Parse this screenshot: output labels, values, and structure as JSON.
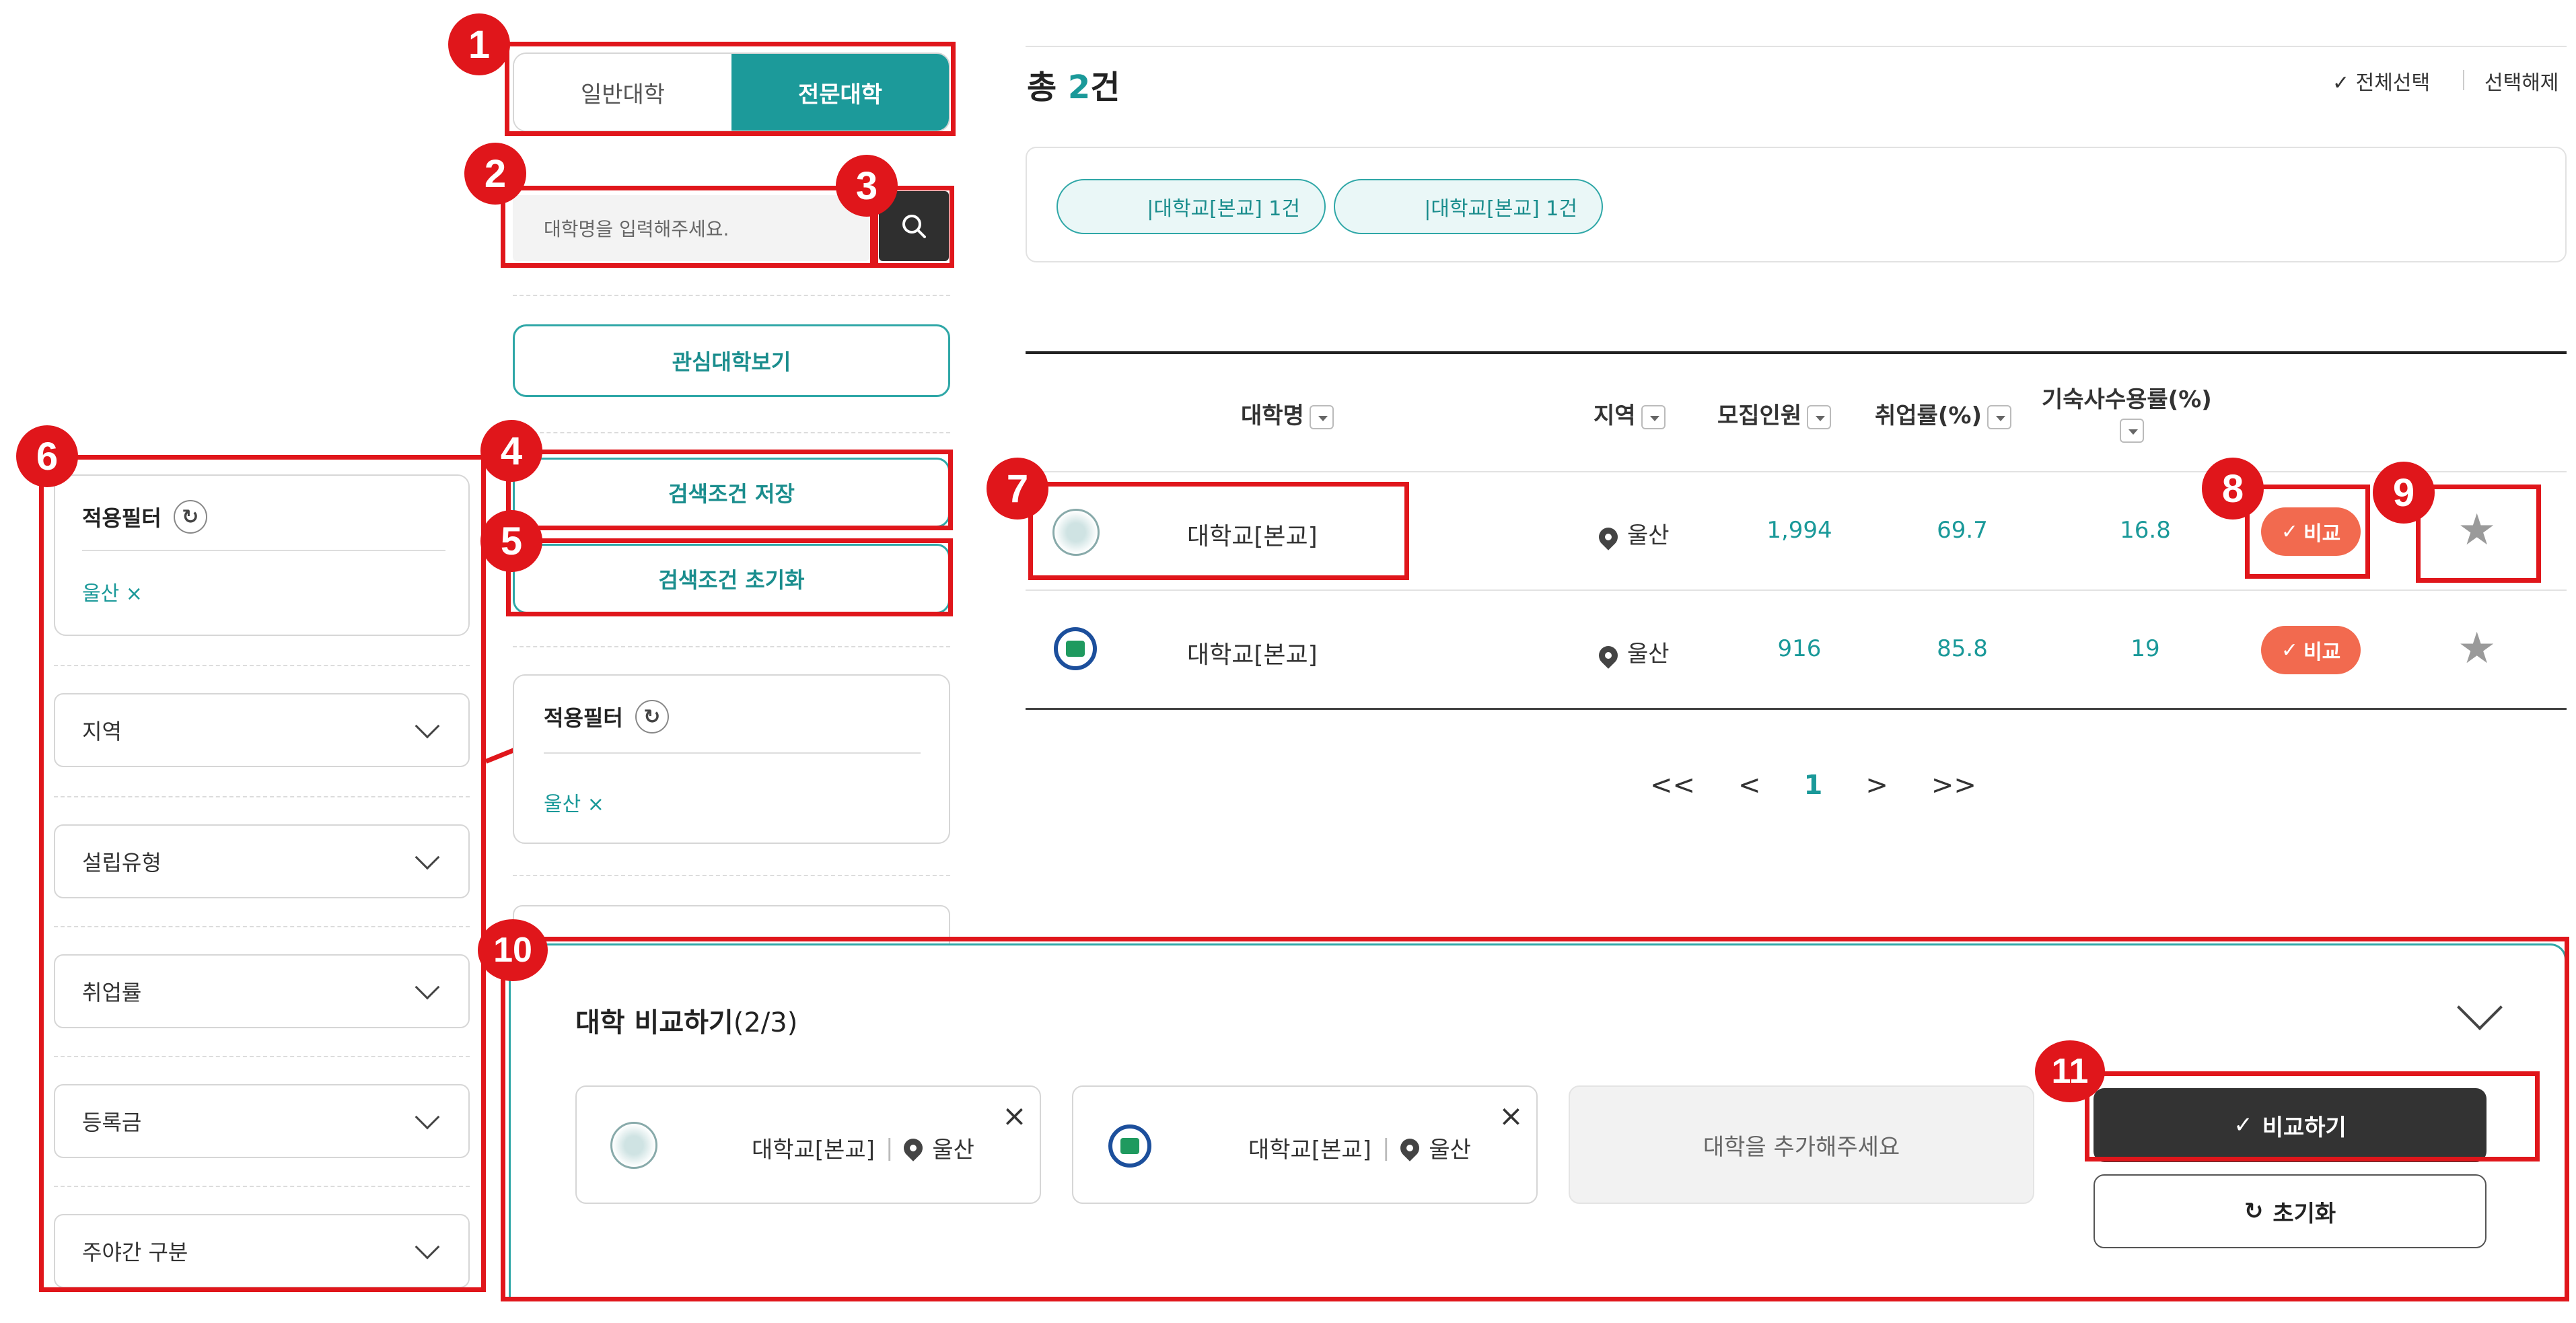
{
  "tabs": {
    "general": "일반대학",
    "specialty": "전문대학"
  },
  "search": {
    "placeholder": "대학명을 입력해주세요."
  },
  "left": {
    "interest_button": "관심대학보기",
    "save_button": "검색조건 저장",
    "reset_button": "검색조건 초기화",
    "applied_filter_title": "적용필터",
    "applied_filter_value": "울산 ×"
  },
  "far_left": {
    "applied_filter_title": "적용필터",
    "applied_filter_value": "울산 ×",
    "dropdowns": [
      "지역",
      "설립유형",
      "취업률",
      "등록금",
      "주야간 구분"
    ]
  },
  "results": {
    "total_prefix": "총 ",
    "total_count": "2",
    "total_suffix": "건",
    "select_all": "✓ 전체선택",
    "deselect": "선택해제",
    "chips": [
      "|대학교[본교] 1건",
      "|대학교[본교] 1건"
    ]
  },
  "table": {
    "headers": {
      "name": "대학명",
      "region": "지역",
      "recruit": "모집인원",
      "employment": "취업률(%)",
      "dorm": "기숙사수용률(%)"
    },
    "rows": [
      {
        "name": "대학교[본교]",
        "region": "울산",
        "recruit": "1,994",
        "employment": "69.7",
        "dorm": "16.8",
        "compare": "비교"
      },
      {
        "name": "대학교[본교]",
        "region": "울산",
        "recruit": "916",
        "employment": "85.8",
        "dorm": "19",
        "compare": "비교"
      }
    ]
  },
  "pagination": {
    "first": "<<",
    "prev": "<",
    "current": "1",
    "next": ">",
    "last": ">>"
  },
  "compare_panel": {
    "title": "대학 비교하기",
    "count": "(2/3)",
    "cards": [
      {
        "name": "대학교[본교]",
        "region": "울산"
      },
      {
        "name": "대학교[본교]",
        "region": "울산"
      }
    ],
    "empty_slot": "대학을 추가해주세요",
    "compare_button": "비교하기",
    "reset_button": "초기화"
  },
  "annotations": [
    "1",
    "2",
    "3",
    "4",
    "5",
    "6",
    "7",
    "8",
    "9",
    "10",
    "11"
  ],
  "colors": {
    "teal": "#2fa7a7",
    "red_annotation": "#e0161b",
    "compare_orange": "#f26a4f",
    "dark_button": "#333333"
  }
}
